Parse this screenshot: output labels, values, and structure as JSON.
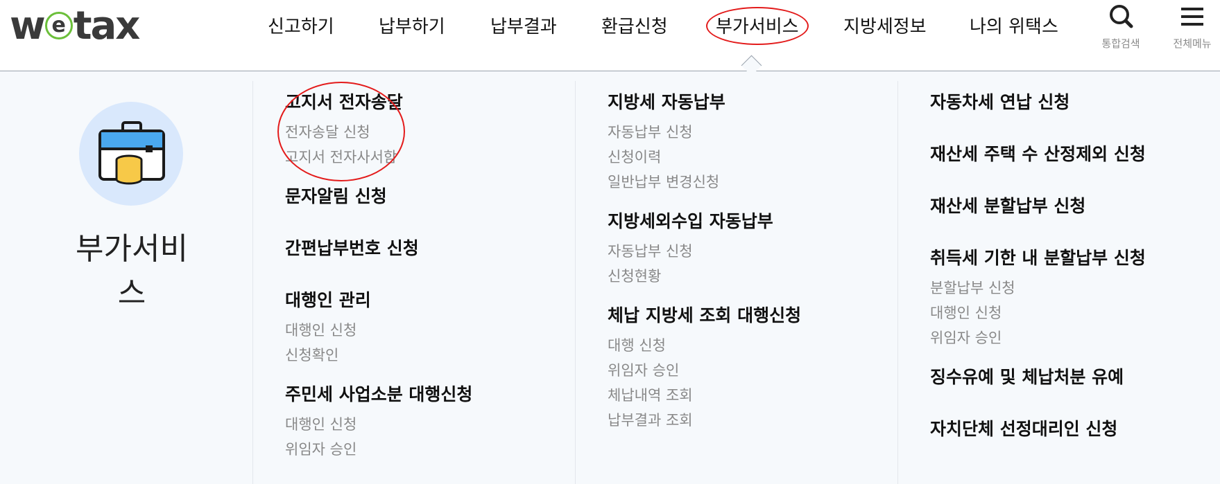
{
  "logo": {
    "prefix": "w",
    "e": "e",
    "suffix": "tax"
  },
  "nav": [
    {
      "label": "신고하기"
    },
    {
      "label": "납부하기"
    },
    {
      "label": "납부결과"
    },
    {
      "label": "환급신청"
    },
    {
      "label": "부가서비스",
      "active": true
    },
    {
      "label": "지방세정보"
    },
    {
      "label": "나의 위택스"
    }
  ],
  "tools": {
    "search": "통합검색",
    "menu": "전체메뉴"
  },
  "section": {
    "title": "부가서비스"
  },
  "columns": [
    [
      {
        "title": "고지서 전자송달",
        "subs": [
          "전자송달 신청",
          "고지서 전자사서함"
        ]
      },
      {
        "title": "문자알림 신청",
        "subs": []
      },
      {
        "title": "간편납부번호 신청",
        "subs": []
      },
      {
        "title": "대행인 관리",
        "subs": [
          "대행인 신청",
          "신청확인"
        ]
      },
      {
        "title": "주민세 사업소분 대행신청",
        "subs": [
          "대행인 신청",
          "위임자 승인"
        ]
      }
    ],
    [
      {
        "title": "지방세 자동납부",
        "subs": [
          "자동납부 신청",
          "신청이력",
          "일반납부 변경신청"
        ]
      },
      {
        "title": "지방세외수입 자동납부",
        "subs": [
          "자동납부 신청",
          "신청현황"
        ]
      },
      {
        "title": "체납 지방세 조회 대행신청",
        "subs": [
          "대행 신청",
          "위임자 승인",
          "체납내역 조회",
          "납부결과 조회"
        ]
      }
    ],
    [
      {
        "title": "자동차세 연납 신청",
        "subs": []
      },
      {
        "title": "재산세 주택 수 산정제외 신청",
        "subs": []
      },
      {
        "title": "재산세 분할납부 신청",
        "subs": []
      },
      {
        "title": "취득세 기한 내 분할납부 신청",
        "subs": [
          "분할납부 신청",
          "대행인 신청",
          "위임자 승인"
        ]
      },
      {
        "title": "징수유예 및 체납처분 유예",
        "subs": []
      },
      {
        "title": "자치단체 선정대리인 신청",
        "subs": []
      }
    ]
  ],
  "colors": {
    "accent_ring": "#e31b1b",
    "logo_green": "#6bbf3a",
    "panel_bg": "#f6f9fc",
    "badge_bg": "#d9e8fc"
  }
}
